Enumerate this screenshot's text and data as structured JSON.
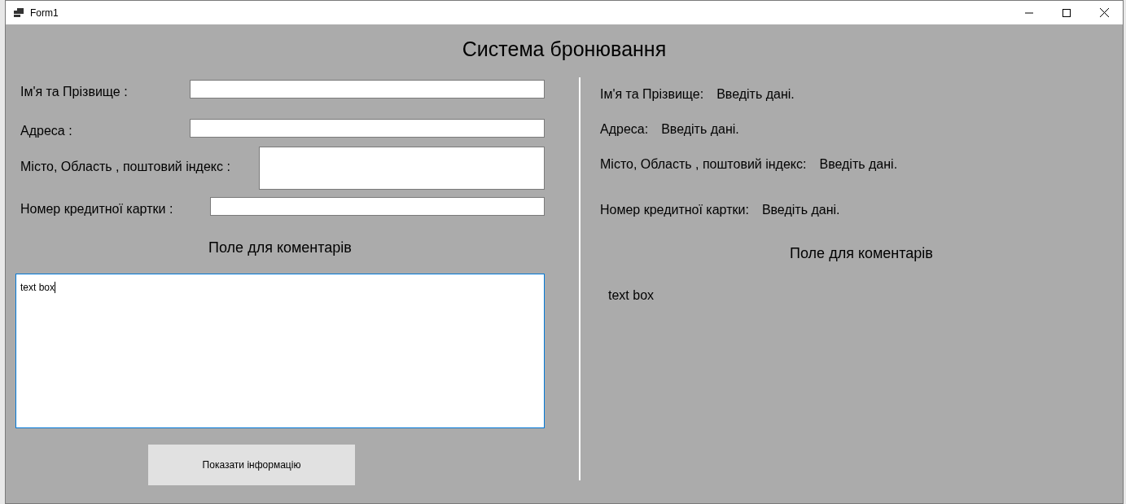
{
  "window": {
    "title": "Form1"
  },
  "heading": "Система бронювання",
  "form": {
    "fields": [
      {
        "kind": "line",
        "label": "Ім'я та Прізвище :"
      },
      {
        "kind": "line",
        "label": "Адреса :"
      },
      {
        "kind": "multi",
        "label": "Місто, Область , поштовий індекс :"
      },
      {
        "kind": "line",
        "label": "Номер кредитної картки :"
      }
    ],
    "comments_heading": "Поле для коментарів",
    "comments": {
      "value": "text box",
      "focused": true
    },
    "button": "Показати інформацію"
  },
  "summary": {
    "rows": [
      {
        "label": "Ім'я та Прізвище:",
        "value": "Введіть дані."
      },
      {
        "label": "Адреса:",
        "value": "Введіть дані."
      },
      {
        "label": "Місто, Область , поштовий індекс:",
        "value": "Введіть дані."
      },
      {
        "label": "Номер кредитної картки:",
        "value": "Введіть дані."
      }
    ],
    "comments_heading": "Поле для коментарів",
    "comments": "text box"
  }
}
